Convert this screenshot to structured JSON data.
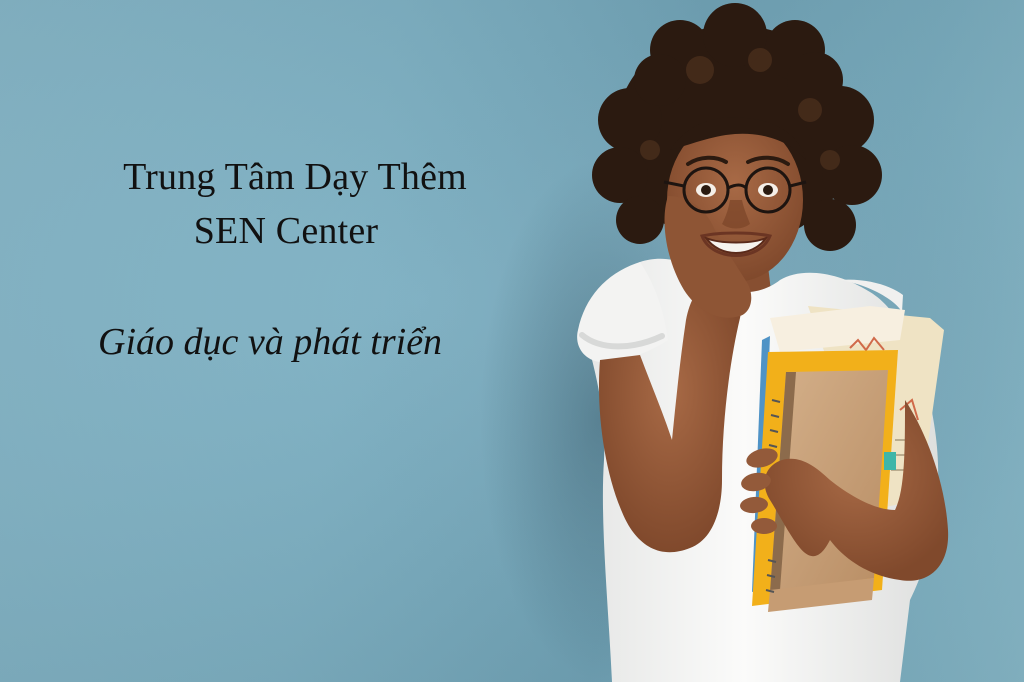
{
  "headline": {
    "line1": "Trung Tâm Dạy Thêm",
    "line2": "SEN Center"
  },
  "slogan": "Giáo dục và phát triển",
  "colors": {
    "background": "#7fb1c4",
    "text": "#111111",
    "shirt": "#f7f7f5",
    "skin": "#9a6040",
    "hair": "#2b1a10",
    "folder_yellow": "#f2b01a",
    "notebook_kraft": "#c9a27a"
  }
}
